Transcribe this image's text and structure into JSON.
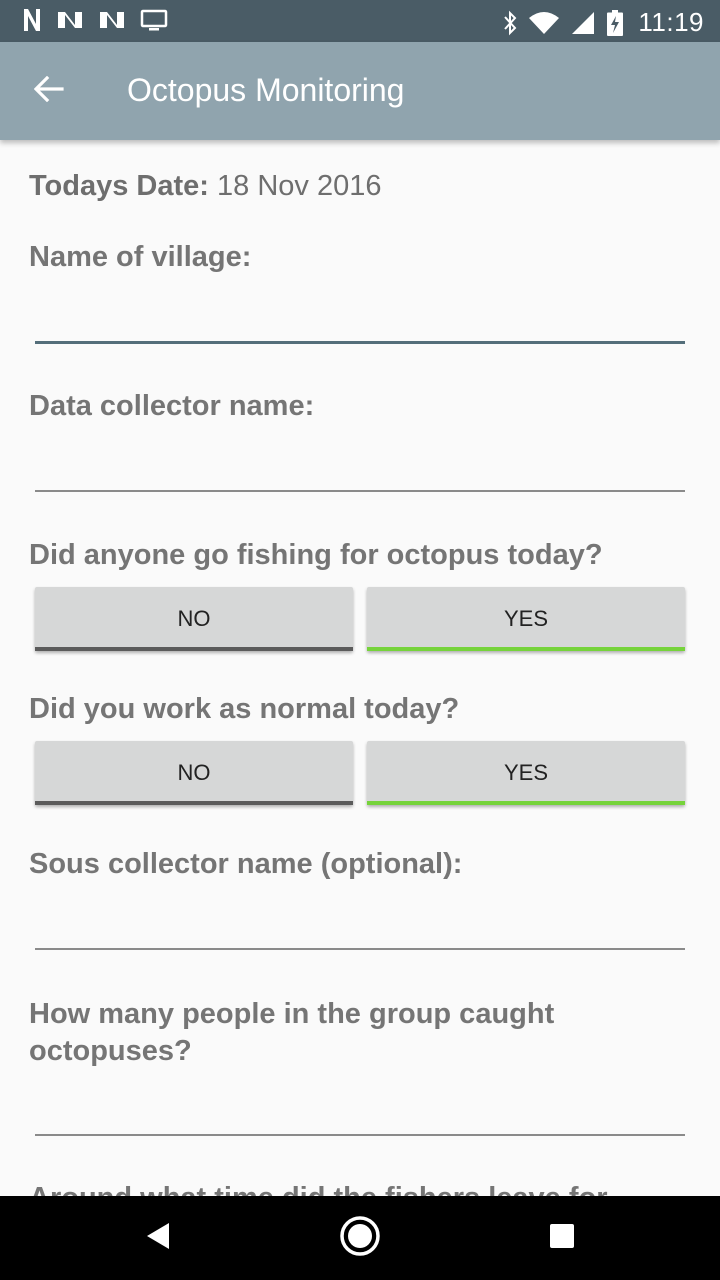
{
  "status_bar": {
    "time": "11:19",
    "left_icons": [
      "n-icon",
      "notification-icon",
      "notification-icon",
      "tv-icon"
    ],
    "right_icons": [
      "bluetooth-icon",
      "wifi-icon",
      "signal-icon",
      "battery-charging-icon"
    ]
  },
  "app_bar": {
    "title": "Octopus Monitoring",
    "back_icon": "arrow-back-icon"
  },
  "form": {
    "date_label": "Todays Date:",
    "date_value": "18 Nov 2016",
    "village_label": "Name of village:",
    "village_value": "",
    "collector_label": "Data collector name:",
    "collector_value": "",
    "fishing_question": "Did anyone go fishing for octopus today?",
    "fishing_no": "NO",
    "fishing_yes": "YES",
    "fishing_selected": "YES",
    "work_question": "Did you work as normal today?",
    "work_no": "NO",
    "work_yes": "YES",
    "work_selected": "YES",
    "sous_label": "Sous collector name (optional):",
    "sous_value": "",
    "caught_label": "How many people in the group caught octopuses?",
    "caught_value": "",
    "next_label_partial": "Around what time did the fishers leave for"
  },
  "colors": {
    "status_bar": "#4a5c66",
    "app_bar": "#90a4ae",
    "selected_indicator": "#76d33b",
    "unselected_indicator": "#5b5b5b"
  },
  "nav_bar": {
    "icons": [
      "nav-back-icon",
      "nav-home-icon",
      "nav-recents-icon"
    ]
  }
}
